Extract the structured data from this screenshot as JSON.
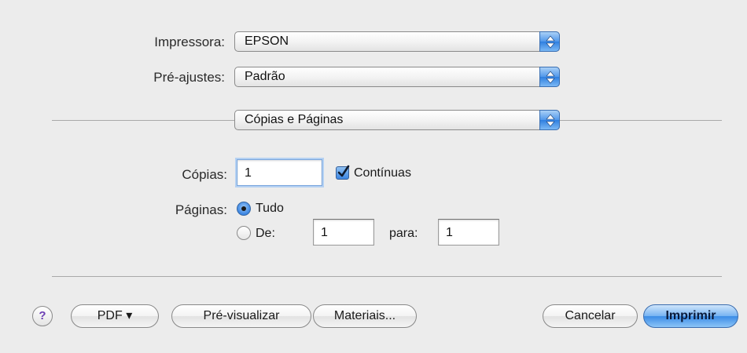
{
  "printer": {
    "label": "Impressora:",
    "value": "EPSON"
  },
  "presets": {
    "label": "Pré-ajustes:",
    "value": "Padrão"
  },
  "section": {
    "value": "Cópias e Páginas"
  },
  "copies": {
    "label": "Cópias:",
    "value": "1",
    "collated_label": "Contínuas",
    "collated": true
  },
  "pages": {
    "label": "Páginas:",
    "all_label": "Tudo",
    "from_label": "De:",
    "from_value": "1",
    "to_label": "para:",
    "to_value": "1",
    "selected": "all"
  },
  "buttons": {
    "help": "?",
    "pdf": "PDF ▾",
    "preview": "Pré-visualizar",
    "supplies": "Materiais...",
    "cancel": "Cancelar",
    "print": "Imprimir"
  },
  "colors": {
    "accent": "#3b8ce6",
    "help_glyph": "#6c3fb4"
  },
  "icons": {
    "popup_stepper": "up-down-arrows-icon",
    "check": "checkmark-icon",
    "help": "question-mark-icon"
  }
}
